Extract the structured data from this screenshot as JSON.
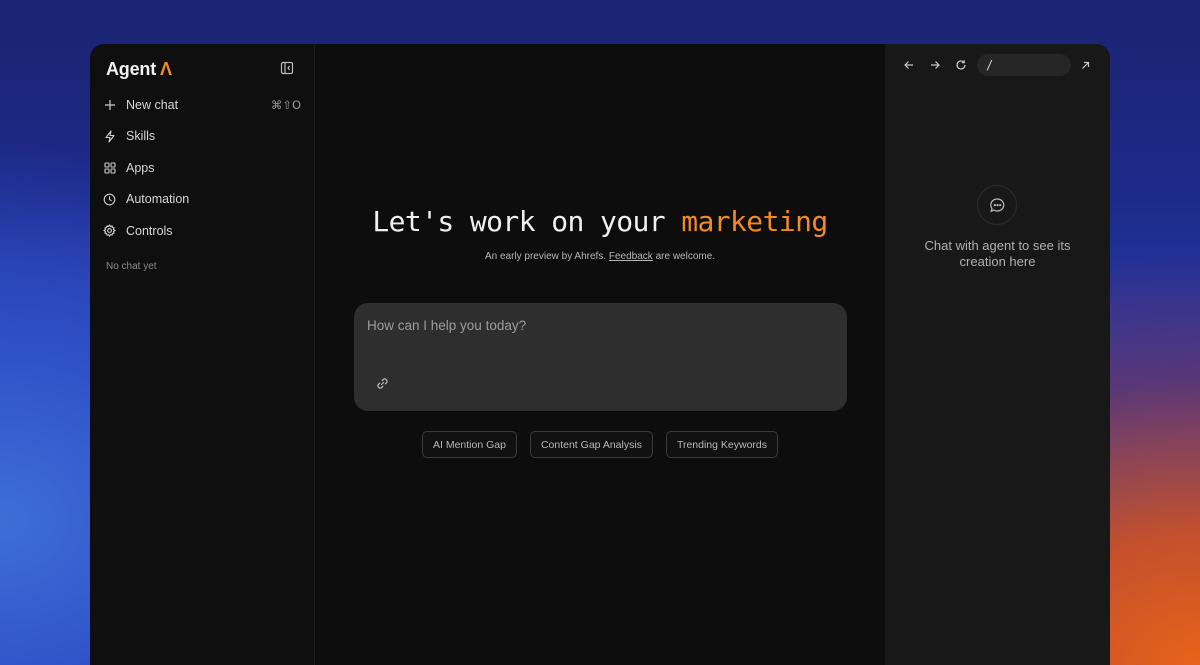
{
  "brand": {
    "name": "Agent",
    "mark": "Λ"
  },
  "sidebar": {
    "items": [
      {
        "label": "New chat",
        "icon": "plus-icon",
        "shortcut": "⌘⇧O"
      },
      {
        "label": "Skills",
        "icon": "lightning-icon"
      },
      {
        "label": "Apps",
        "icon": "grid-icon"
      },
      {
        "label": "Automation",
        "icon": "clock-icon"
      },
      {
        "label": "Controls",
        "icon": "gear-icon"
      }
    ],
    "empty_hint": "No chat yet"
  },
  "main": {
    "headline_prefix": "Let's work on your",
    "headline_accent": "marketing",
    "sub_prefix": "An early preview by Ahrefs.",
    "sub_link": "Feedback",
    "sub_suffix": "are welcome.",
    "prompt_placeholder": "How can I help you today?",
    "chips": [
      "AI Mention Gap",
      "Content Gap Analysis",
      "Trending Keywords"
    ]
  },
  "panel": {
    "url": "/",
    "hint_line1": "Chat with agent to see its",
    "hint_line2": "creation here"
  },
  "colors": {
    "accent": "#f08a24",
    "window_bg": "#0e0e0e",
    "panel_bg": "#181818",
    "input_bg": "#2e2e2e"
  }
}
